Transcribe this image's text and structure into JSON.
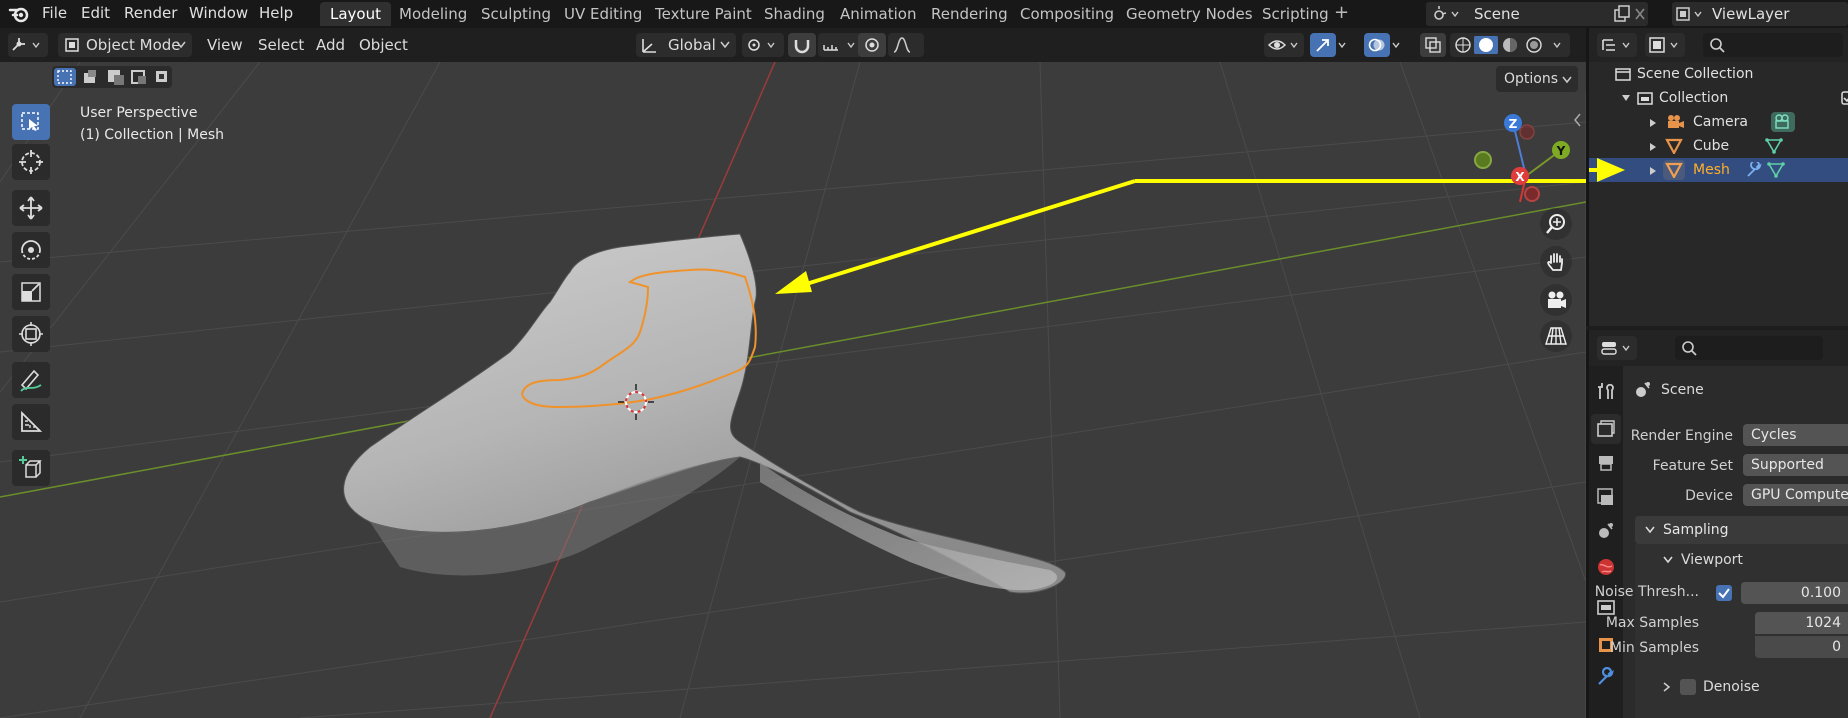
{
  "topbar": {
    "menus": [
      "File",
      "Edit",
      "Render",
      "Window",
      "Help"
    ],
    "workspace_tabs": [
      "Layout",
      "Modeling",
      "Sculpting",
      "UV Editing",
      "Texture Paint",
      "Shading",
      "Animation",
      "Rendering",
      "Compositing",
      "Geometry Nodes",
      "Scripting"
    ],
    "active_tab": "Layout",
    "add_tab": "+",
    "scene_name": "Scene",
    "view_layer": "ViewLayer"
  },
  "viewport_header": {
    "mode": "Object Mode",
    "menus": [
      "View",
      "Select",
      "Add",
      "Object"
    ],
    "orientation": "Global",
    "options": "Options"
  },
  "viewport": {
    "perspective": "User Perspective",
    "collection_info": "(1) Collection | Mesh",
    "gizmo": {
      "z": "Z",
      "y": "Y",
      "x": "X"
    },
    "tools": [
      "select-box",
      "cursor",
      "move",
      "rotate",
      "scale",
      "transform",
      "annotate",
      "measure",
      "add-cube"
    ]
  },
  "outliner": {
    "scene_collection": "Scene Collection",
    "collection": "Collection",
    "items": [
      {
        "name": "Camera",
        "icon": "camera-icon"
      },
      {
        "name": "Cube",
        "icon": "mesh-icon"
      },
      {
        "name": "Mesh",
        "icon": "mesh-icon",
        "selected": true
      }
    ]
  },
  "properties": {
    "context": "Scene",
    "render_engine_label": "Render Engine",
    "render_engine": "Cycles",
    "feature_set_label": "Feature Set",
    "feature_set": "Supported",
    "device_label": "Device",
    "device": "GPU Compute",
    "sampling": "Sampling",
    "viewport": "Viewport",
    "noise_label": "Noise Thresh...",
    "noise_value": "0.100",
    "max_samples_label": "Max Samples",
    "max_samples": "1024",
    "min_samples_label": "Min Samples",
    "min_samples": "0",
    "denoise": "Denoise"
  },
  "colors": {
    "accent": "#4772b3",
    "selected_row": "#334d80",
    "selection_outline": "#f0922b",
    "annotation_arrow": "#ffff00"
  }
}
